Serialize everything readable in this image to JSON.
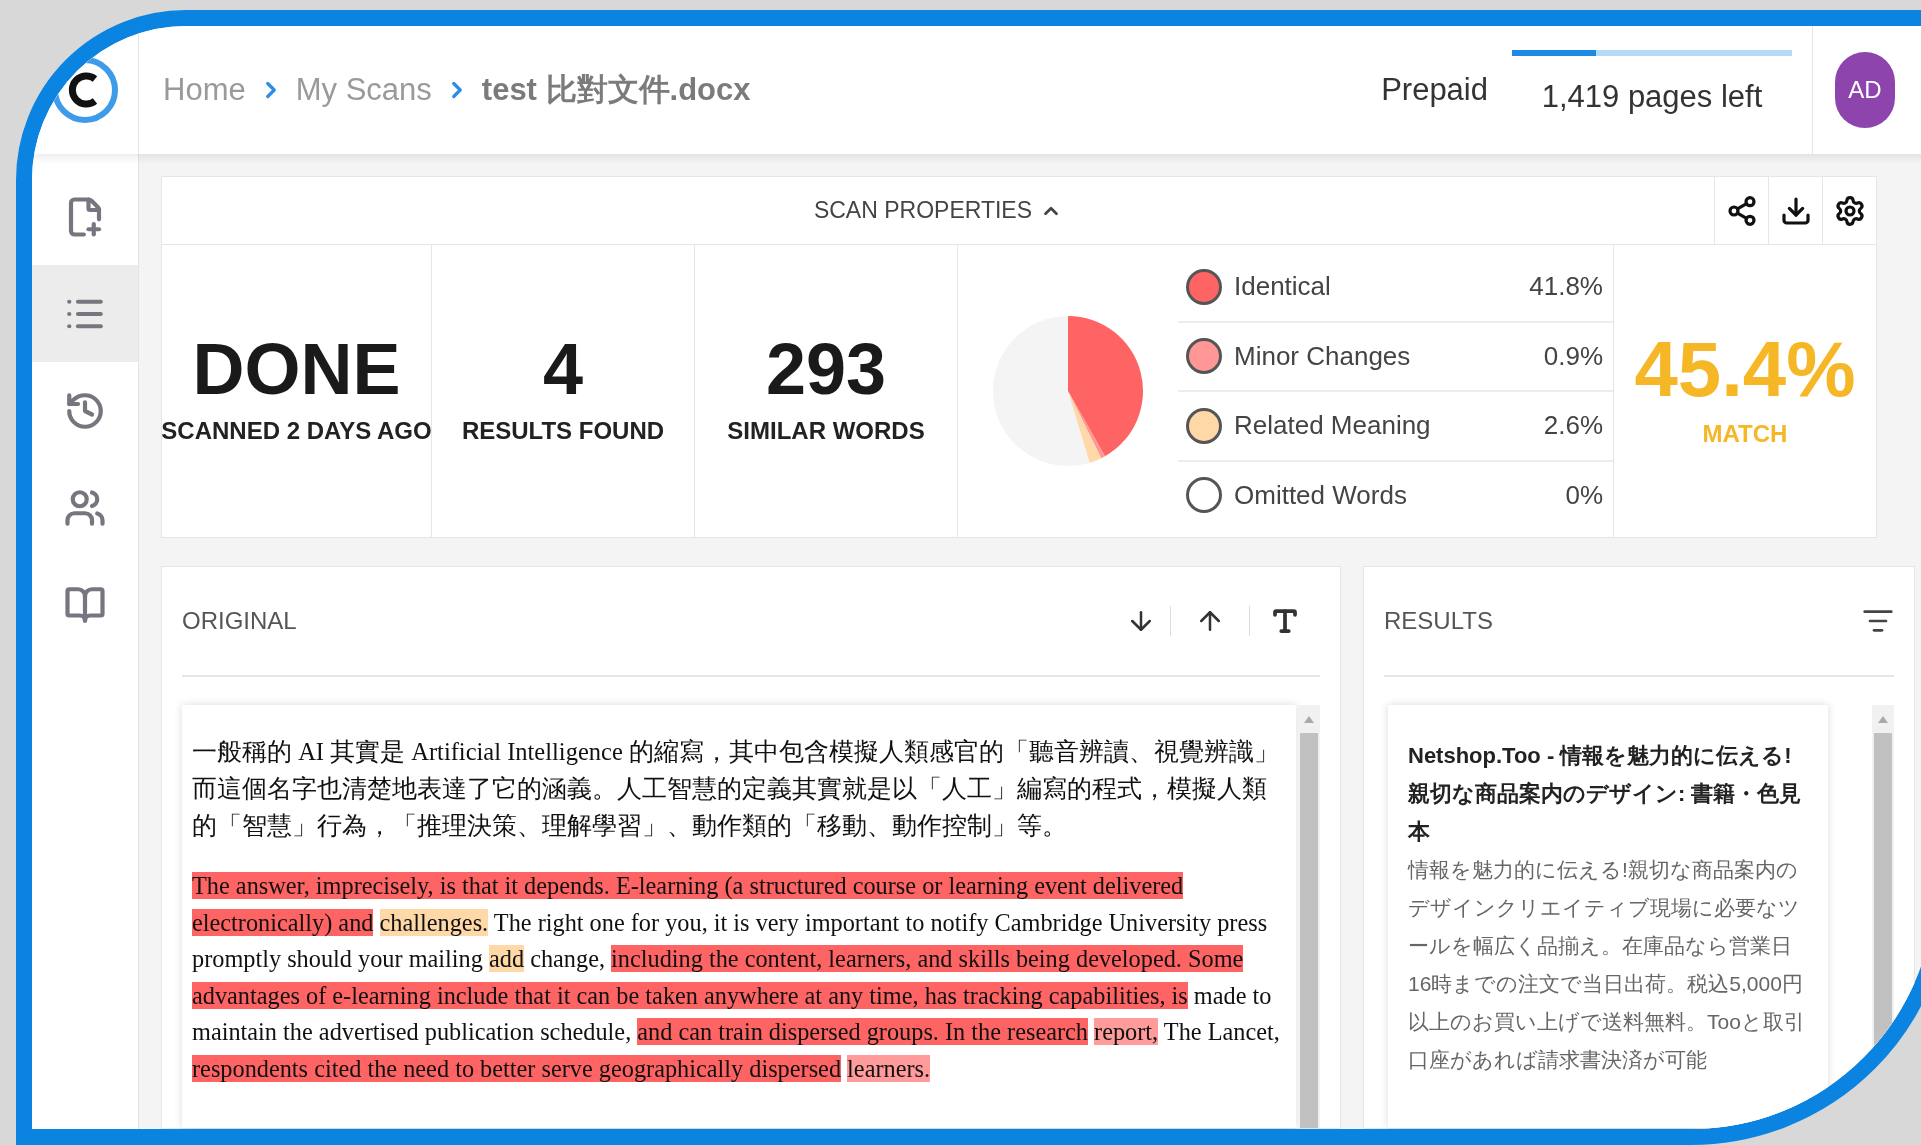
{
  "breadcrumb": [
    {
      "label": "Home",
      "current": false
    },
    {
      "label": "My Scans",
      "current": false
    },
    {
      "label": "test 比對文件.docx",
      "current": true
    }
  ],
  "plan": {
    "label": "Prepaid",
    "pages": "1,419 pages left",
    "level": 0.3
  },
  "avatar": {
    "initials": "AD"
  },
  "sidebar": {
    "items": [
      {
        "kind": "new-scan",
        "selected": false
      },
      {
        "kind": "list",
        "selected": true
      },
      {
        "kind": "history",
        "selected": false
      },
      {
        "kind": "users",
        "selected": false
      },
      {
        "kind": "compare",
        "selected": false
      }
    ]
  },
  "scan_properties": {
    "title": "SCAN PROPERTIES",
    "stats": [
      {
        "value": "DONE",
        "label": "SCANNED 2 DAYS AGO"
      },
      {
        "value": "4",
        "label": "RESULTS FOUND"
      },
      {
        "value": "293",
        "label": "SIMILAR WORDS"
      }
    ],
    "legend": [
      {
        "label": "Identical",
        "percent": "41.8%",
        "color": "#ff6464"
      },
      {
        "label": "Minor Changes",
        "percent": "0.9%",
        "color": "#ff9797"
      },
      {
        "label": "Related Meaning",
        "percent": "2.6%",
        "color": "#ffd8a8"
      },
      {
        "label": "Omitted Words",
        "percent": "0%",
        "color": "#ffffff"
      }
    ],
    "match": {
      "value": "45.4%",
      "label": "MATCH"
    }
  },
  "original": {
    "title": "ORIGINAL",
    "paragraph": "一般稱的 AI 其實是 Artificial Intelligence 的縮寫，其中包含模擬人類感官的「聽音辨讀、視覺辨識」而這個名字也清楚地表達了它的涵義。人工智慧的定義其實就是以「人工」編寫的程式，模擬人類的「智慧」行為，「推理決策、理解學習」、動作類的「移動、動作控制」等。",
    "segments": [
      {
        "text": "The answer, imprecisely, is that it depends. E-learning (a structured course or learning event delivered electronically) and",
        "kind": "identical"
      },
      {
        "text": "challenges.",
        "kind": "related"
      },
      {
        "text": "The right one for you, it is very important to notify Cambridge University press promptly should your mailing",
        "kind": "none"
      },
      {
        "text": "add",
        "kind": "related"
      },
      {
        "text": "change,",
        "kind": "none"
      },
      {
        "text": "including the content, learners, and skills being developed. Some advantages of e-learning include that it can be taken anywhere at any time, has tracking capabilities, is",
        "kind": "identical"
      },
      {
        "text": "made to maintain the advertised publication schedule,",
        "kind": "none"
      },
      {
        "text": "and can train dispersed groups. In the research",
        "kind": "identical"
      },
      {
        "text": "report,",
        "kind": "minor"
      },
      {
        "text": "The Lancet,",
        "kind": "none"
      },
      {
        "text": "respondents cited the need to better serve geographically dispersed",
        "kind": "identical"
      },
      {
        "text": "learners.",
        "kind": "minor"
      }
    ]
  },
  "results": {
    "title": "RESULTS",
    "items": [
      {
        "title": "Netshop.Too - 情報を魅力的に伝える!親切な商品案内のデザイン: 書籍・色見本",
        "description": "情報を魅力的に伝える!親切な商品案内のデザインクリエイティブ現場に必要なツールを幅広く品揃え。在庫品なら営業日16時までの注文で当日出荷。税込5,000円以上のお買い上げで送料無料。Tooと取引口座があれば請求書決済が可能"
      }
    ]
  }
}
